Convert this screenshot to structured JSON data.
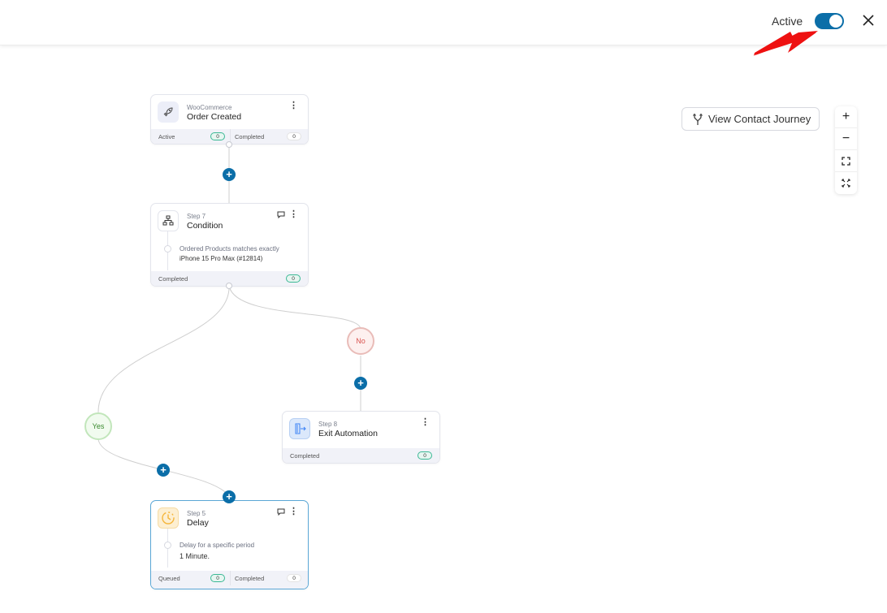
{
  "header": {
    "active_label": "Active",
    "toggle_on": true,
    "close_icon": "close-icon"
  },
  "colors": {
    "accent": "#0b6ea8",
    "yes": "#3a8a2f",
    "no": "#d9534f",
    "annotation_arrow": "#ee1111"
  },
  "toolbar": {
    "journey_label": "View Contact Journey",
    "journey_icon": "branch-merge-icon",
    "zoom_in": "+",
    "zoom_out": "−",
    "fit_icon": "fit-screen-icon",
    "fullscreen_icon": "fullscreen-icon"
  },
  "nodes": {
    "trigger": {
      "subtitle": "WooCommerce",
      "title": "Order Created",
      "icon": "rocket-icon",
      "stats": [
        {
          "label": "Active",
          "value": "0"
        },
        {
          "label": "Completed",
          "value": "0"
        }
      ]
    },
    "condition": {
      "subtitle": "Step 7",
      "title": "Condition",
      "icon": "sitemap-icon",
      "rule_label": "Ordered Products matches exactly",
      "rule_value": "iPhone 15 Pro Max (#12814)",
      "stats": [
        {
          "label": "Completed",
          "value": "0"
        }
      ]
    },
    "exit": {
      "subtitle": "Step 8",
      "title": "Exit Automation",
      "icon": "exit-door-icon",
      "stats": [
        {
          "label": "Completed",
          "value": "0"
        }
      ]
    },
    "delay": {
      "subtitle": "Step 5",
      "title": "Delay",
      "icon": "clock-icon",
      "rule_label": "Delay for a specific period",
      "rule_value": "1 Minute.",
      "stats": [
        {
          "label": "Queued",
          "value": "0"
        },
        {
          "label": "Completed",
          "value": "0"
        }
      ]
    }
  },
  "branches": {
    "yes": "Yes",
    "no": "No"
  },
  "add_step_symbol": "+"
}
